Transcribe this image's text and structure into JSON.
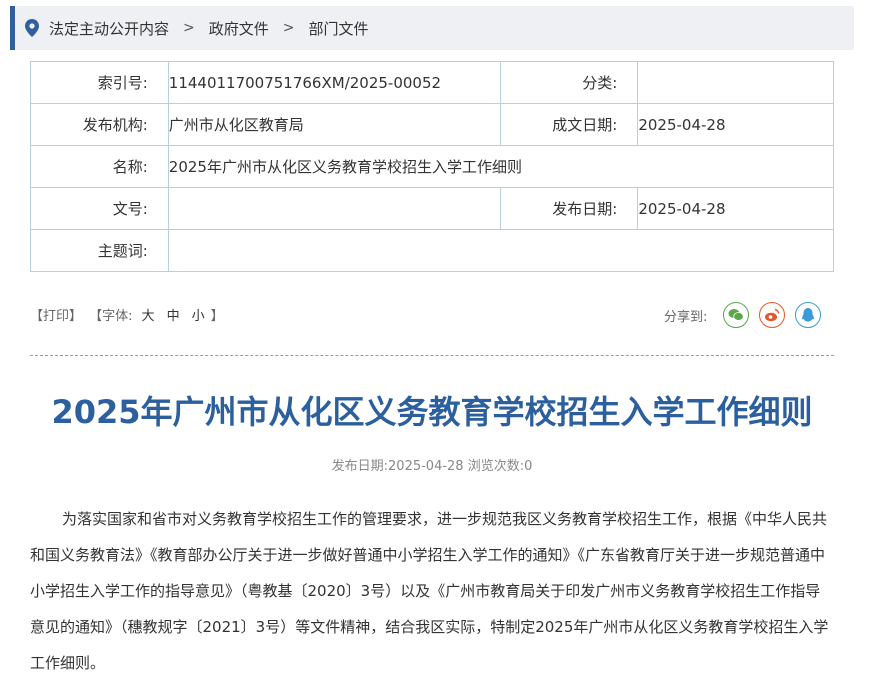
{
  "breadcrumb": [
    "法定主动公开内容",
    "政府文件",
    "部门文件"
  ],
  "meta": {
    "index_label": "索引号:",
    "index_value": "1144011700751766XM/2025-00052",
    "category_label": "分类:",
    "category_value": "",
    "issuer_label": "发布机构:",
    "issuer_value": "广州市从化区教育局",
    "written_label": "成文日期:",
    "written_value": "2025-04-28",
    "name_label": "名称:",
    "name_value": "2025年广州市从化区义务教育学校招生入学工作细则",
    "docno_label": "文号:",
    "docno_value": "",
    "pubdate_label": "发布日期:",
    "pubdate_value": "2025-04-28",
    "subject_label": "主题词:",
    "subject_value": ""
  },
  "tools": {
    "print": "【打印】",
    "font_prefix": "【字体:",
    "font_large": "大",
    "font_medium": "中",
    "font_small": "小",
    "font_suffix": "】",
    "share_label": "分享到:"
  },
  "share_colors": {
    "wechat": "#5aa84a",
    "weibo": "#e4572e",
    "qq": "#3b9bd8"
  },
  "article": {
    "title": "2025年广州市从化区义务教育学校招生入学工作细则",
    "pubinfo": "发布日期:2025-04-28  浏览次数:0",
    "paragraph": "为落实国家和省市对义务教育学校招生工作的管理要求，进一步规范我区义务教育学校招生工作，根据《中华人民共和国义务教育法》《教育部办公厅关于进一步做好普通中小学招生入学工作的通知》《广东省教育厅关于进一步规范普通中小学招生入学工作的指导意见》（粤教基〔2020〕3号）以及《广州市教育局关于印发广州市义务教育学校招生工作指导意见的通知》（穗教规字〔2021〕3号）等文件精神，结合我区实际，特制定2025年广州市从化区义务教育学校招生入学工作细则。"
  }
}
